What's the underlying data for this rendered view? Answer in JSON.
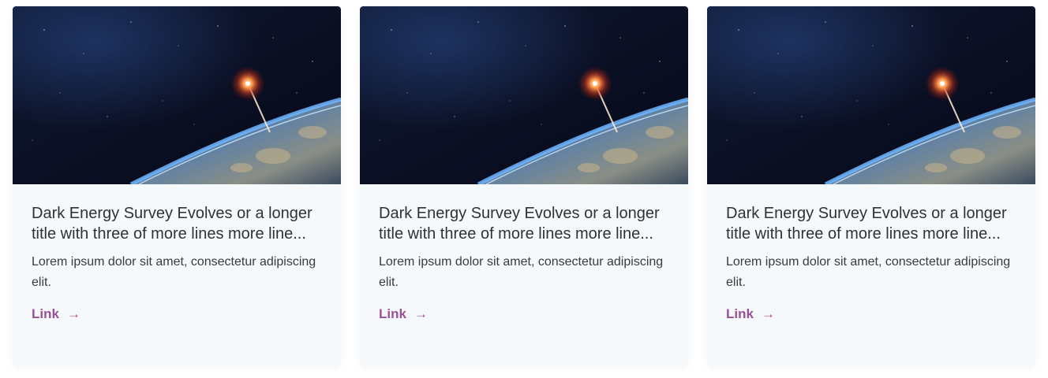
{
  "cards": [
    {
      "title": "Dark Energy Survey Evolves or a longer title with three of more lines more line...",
      "description": "Lorem ipsum dolor sit amet, consectetur adipiscing elit.",
      "link_label": "Link",
      "link_icon": "arrow-right-icon"
    },
    {
      "title": "Dark Energy Survey Evolves or a longer title with three of more lines more line...",
      "description": "Lorem ipsum dolor sit amet, consectetur adipiscing elit.",
      "link_label": "Link",
      "link_icon": "arrow-right-icon"
    },
    {
      "title": "Dark Energy Survey Evolves or a longer title with three of more lines more line...",
      "description": "Lorem ipsum dolor sit amet, consectetur adipiscing elit.",
      "link_label": "Link",
      "link_icon": "arrow-right-icon"
    }
  ],
  "colors": {
    "card_background": "#f6f9fb",
    "title_text": "#313131",
    "body_text": "#3a3a3a",
    "link_accent": "#9b4f96"
  }
}
